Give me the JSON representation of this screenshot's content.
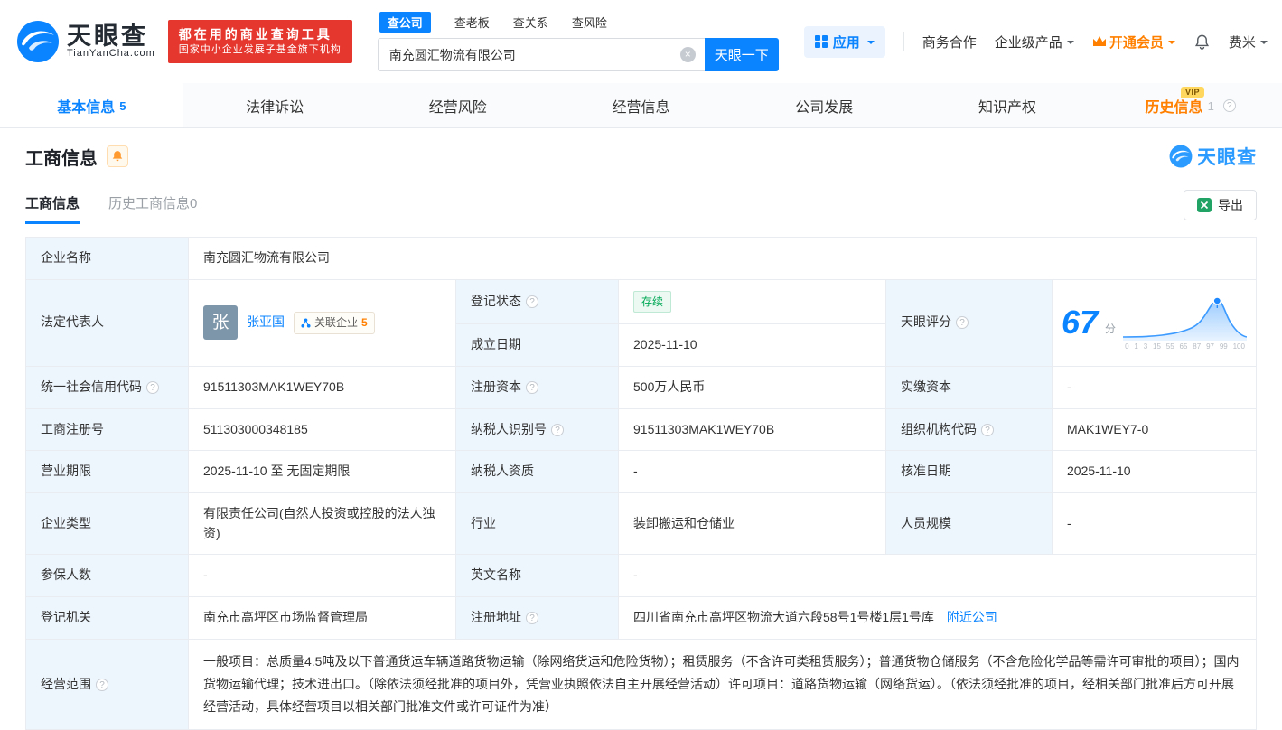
{
  "colors": {
    "brand_blue": "#0b84ff",
    "slogan_red": "#e6372e",
    "vip_orange": "#ff8000",
    "status_green": "#00a854",
    "label_cell_bg": "#eef6fd"
  },
  "header": {
    "brand": "天眼查",
    "brand_domain": "TianYanCha.com",
    "slogan_line1": "都在用的商业查询工具",
    "slogan_line2": "国家中小企业发展子基金旗下机构",
    "search_tabs": [
      {
        "label": "查公司",
        "active": true
      },
      {
        "label": "查老板",
        "active": false
      },
      {
        "label": "查关系",
        "active": false
      },
      {
        "label": "查风险",
        "active": false
      }
    ],
    "search_value": "南充圆汇物流有限公司",
    "search_button": "天眼一下",
    "nav_apps": "应用",
    "nav_coop": "商务合作",
    "nav_enterprise": "企业级产品",
    "nav_vip": "开通会员",
    "nav_user": "费米"
  },
  "tabs": [
    {
      "label": "基本信息",
      "count": "5",
      "active": true
    },
    {
      "label": "法律诉讼"
    },
    {
      "label": "经营风险"
    },
    {
      "label": "经营信息"
    },
    {
      "label": "公司发展"
    },
    {
      "label": "知识产权"
    },
    {
      "label": "历史信息",
      "count": "1",
      "badge": "VIP"
    }
  ],
  "section_title": "工商信息",
  "watermark_brand": "天眼查",
  "subtabs": [
    {
      "label": "工商信息",
      "active": true
    },
    {
      "label": "历史工商信息0",
      "active": false
    }
  ],
  "export_label": "导出",
  "biz": {
    "name_label": "企业名称",
    "name": "南充圆汇物流有限公司",
    "legal_rep_label": "法定代表人",
    "legal_rep_avatar": "张",
    "legal_rep": "张亚国",
    "related_label": "关联企业",
    "related_count": "5",
    "reg_status_label": "登记状态",
    "reg_status": "存续",
    "establish_label": "成立日期",
    "establish_date": "2025-11-10",
    "score_label": "天眼评分",
    "credit_code_label": "统一社会信用代码",
    "credit_code": "91511303MAK1WEY70B",
    "reg_capital_label": "注册资本",
    "reg_capital": "500万人民币",
    "paid_capital_label": "实缴资本",
    "paid_capital": "-",
    "reg_number_label": "工商注册号",
    "reg_number": "511303000348185",
    "taxpayer_id_label": "纳税人识别号",
    "taxpayer_id": "91511303MAK1WEY70B",
    "org_code_label": "组织机构代码",
    "org_code": "MAK1WEY7-0",
    "business_term_label": "营业期限",
    "business_term": "2025-11-10 至 无固定期限",
    "taxpayer_quality_label": "纳税人资质",
    "taxpayer_quality": "-",
    "approval_date_label": "核准日期",
    "approval_date": "2025-11-10",
    "company_type_label": "企业类型",
    "company_type": "有限责任公司(自然人投资或控股的法人独资)",
    "industry_label": "行业",
    "industry": "装卸搬运和仓储业",
    "staff_size_label": "人员规模",
    "staff_size": "-",
    "insured_label": "参保人数",
    "insured": "-",
    "english_name_label": "英文名称",
    "english_name": "-",
    "registry_label": "登记机关",
    "registry": "南充市高坪区市场监督管理局",
    "address_label": "注册地址",
    "address": "四川省南充市高坪区物流大道六段58号1号楼1层1号库",
    "nearby_link": "附近公司",
    "scope_label": "经营范围",
    "scope": "一般项目：总质量4.5吨及以下普通货运车辆道路货物运输（除网络货运和危险货物）；租赁服务（不含许可类租赁服务）；普通货物仓储服务（不含危险化学品等需许可审批的项目）；国内货物运输代理；技术进出口。（除依法须经批准的项目外，凭营业执照依法自主开展经营活动）许可项目：道路货物运输（网络货运）。（依法须经批准的项目，经相关部门批准后方可开展经营活动，具体经营项目以相关部门批准文件或许可证件为准）"
  },
  "score": {
    "value": "67",
    "unit": "分",
    "axis": [
      "0",
      "1",
      "3",
      "15",
      "55",
      "65",
      "87",
      "97",
      "99",
      "100"
    ]
  }
}
